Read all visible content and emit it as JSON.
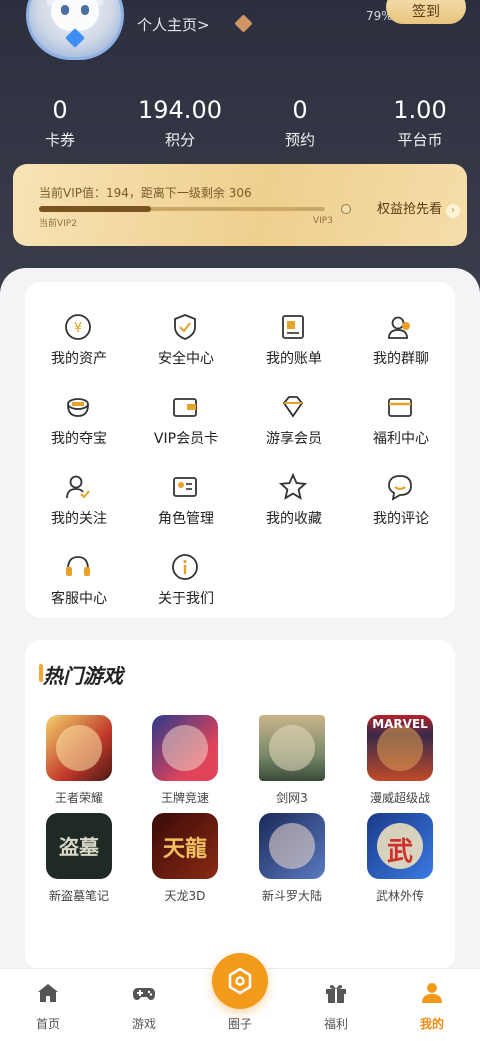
{
  "header": {
    "profile_link": "个人主页>",
    "battery": "79%",
    "sign_in": "签到"
  },
  "stats": [
    {
      "value": "0",
      "label": "卡券"
    },
    {
      "value": "194.00",
      "label": "积分"
    },
    {
      "value": "0",
      "label": "预约"
    },
    {
      "value": "1.00",
      "label": "平台币"
    }
  ],
  "vip": {
    "text": "当前VIP值：194，距离下一级剩余 306",
    "current_level": "当前VIP2",
    "next_level": "VIP3",
    "benefit": "权益抢先看",
    "progress": 0.39
  },
  "menu": [
    {
      "label": "我的资产",
      "icon": "coin-icon"
    },
    {
      "label": "安全中心",
      "icon": "shield-icon"
    },
    {
      "label": "我的账单",
      "icon": "bill-icon"
    },
    {
      "label": "我的群聊",
      "icon": "group-chat-icon"
    },
    {
      "label": "我的夺宝",
      "icon": "treasure-icon"
    },
    {
      "label": "VIP会员卡",
      "icon": "wallet-icon"
    },
    {
      "label": "游享会员",
      "icon": "diamond-icon"
    },
    {
      "label": "福利中心",
      "icon": "card-icon"
    },
    {
      "label": "我的关注",
      "icon": "follow-user-icon"
    },
    {
      "label": "角色管理",
      "icon": "role-card-icon"
    },
    {
      "label": "我的收藏",
      "icon": "star-icon"
    },
    {
      "label": "我的评论",
      "icon": "comment-icon"
    },
    {
      "label": "客服中心",
      "icon": "headset-icon"
    },
    {
      "label": "关于我们",
      "icon": "info-icon"
    }
  ],
  "games": {
    "title": "热门游戏",
    "items": [
      {
        "name": "王者荣耀",
        "badge": "",
        "color": "#c0392b"
      },
      {
        "name": "王牌竞速",
        "badge": "",
        "color": "#2b3a8a"
      },
      {
        "name": "剑网3",
        "badge": "",
        "color": "#7a8a6a"
      },
      {
        "name": "漫威超级战",
        "badge": "MARVEL",
        "color": "#3a2a4a"
      },
      {
        "name": "新盗墓笔记",
        "badge": "盗墓",
        "color": "#1f2a24"
      },
      {
        "name": "天龙3D",
        "badge": "天龍",
        "color": "#6a1a14"
      },
      {
        "name": "新斗罗大陆",
        "badge": "",
        "color": "#2a3a6a"
      },
      {
        "name": "武林外传",
        "badge": "武",
        "color": "#2a4a8a"
      }
    ]
  },
  "tabs": [
    {
      "label": "首页",
      "icon": "home-icon"
    },
    {
      "label": "游戏",
      "icon": "gamepad-icon"
    },
    {
      "label": "圈子",
      "icon": "hexagon-icon"
    },
    {
      "label": "福利",
      "icon": "gift-icon"
    },
    {
      "label": "我的",
      "icon": "user-icon"
    }
  ],
  "colors": {
    "accent": "#f49a1a",
    "hero_bg": "#2c2f3d",
    "vip_gold": "#efcf8e"
  }
}
